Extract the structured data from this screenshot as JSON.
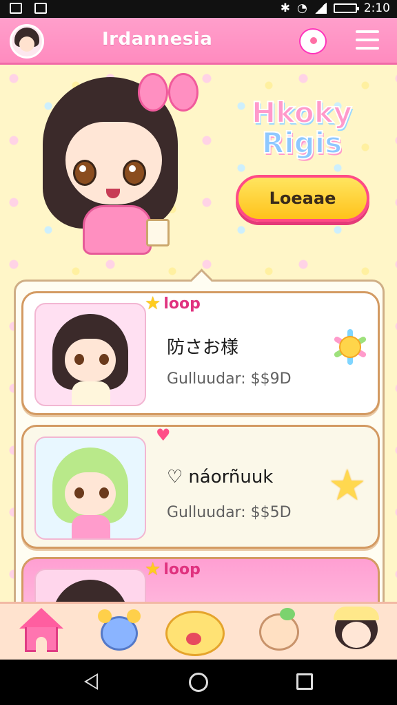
{
  "status_bar": {
    "time": "2:10",
    "icons": [
      "notification-icon",
      "image-icon",
      "bluetooth-icon",
      "wifi-icon",
      "signal-icon",
      "battery-icon"
    ]
  },
  "header": {
    "title": "Irdannesia",
    "avatar": "user-avatar",
    "chat_icon": "chat-bubble-icon",
    "menu_icon": "hamburger-menu-icon"
  },
  "hero": {
    "logo_line1": "Hkoky",
    "logo_line2": "Rigis",
    "cta_label": "Loeaae"
  },
  "cards": [
    {
      "tag": "loop",
      "name": "防さお様",
      "price": "Gulluudar: $$9D",
      "side_icon": "sun-flower-icon"
    },
    {
      "tag": "",
      "name": "náorñuuk",
      "price": "Gulluudar: $$5D",
      "side_icon": "star-face-icon"
    },
    {
      "tag": "loop",
      "name": "",
      "price": ""
    }
  ],
  "bottom_nav": {
    "items": [
      "home-icon",
      "blue-bear-icon",
      "yellow-bear-icon",
      "dog-icon",
      "girl-avatar-icon"
    ]
  },
  "system_nav": {
    "items": [
      "back-icon",
      "home-circle-icon",
      "recents-icon"
    ]
  },
  "colors": {
    "header_pink": "#ff8bbf",
    "background": "#fff6c8",
    "accent_yellow": "#ffc21b",
    "accent_pink": "#ff4b86"
  }
}
